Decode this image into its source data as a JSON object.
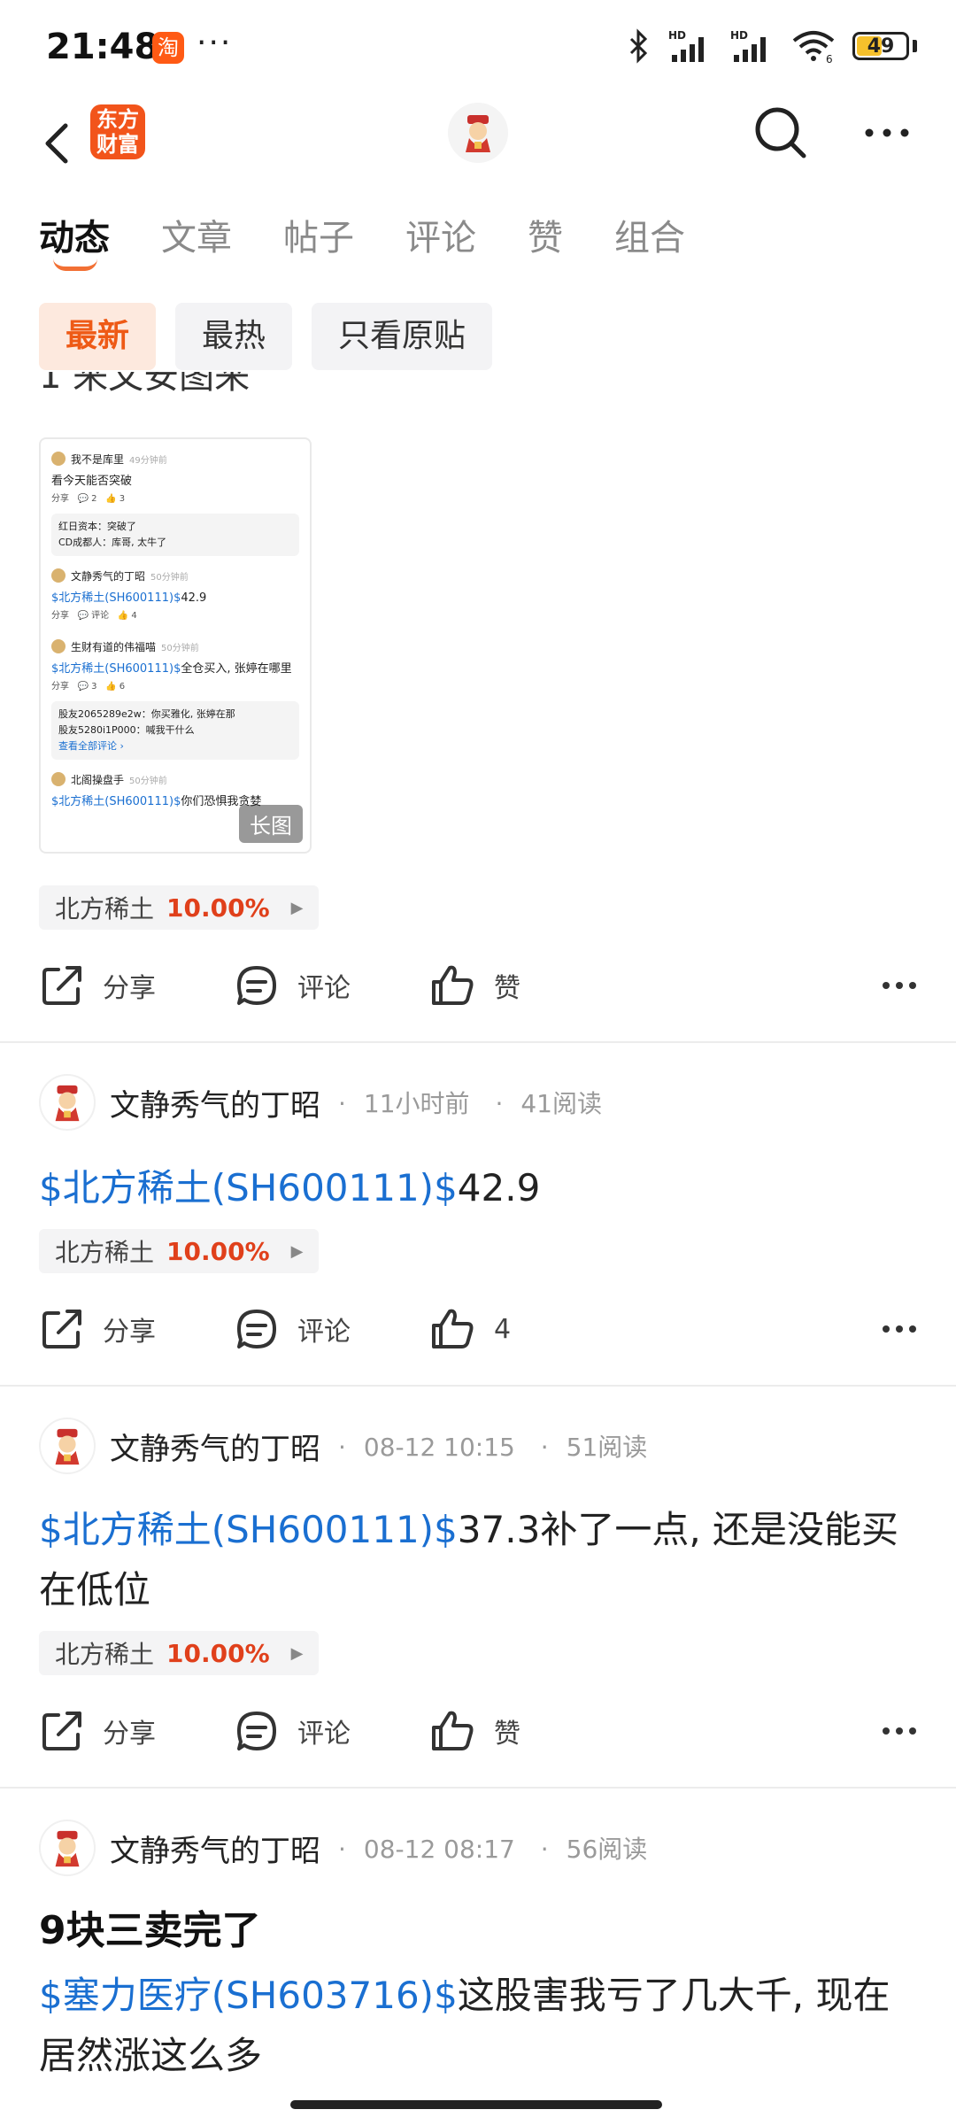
{
  "status": {
    "time": "21:48",
    "taobao_glyph": "淘",
    "more_dots": "···",
    "battery": "49",
    "wifi_badge": "6",
    "hd1": "HD",
    "hd2": "HD"
  },
  "header": {
    "logo_text_line1": "东方",
    "logo_text_line2": "财富"
  },
  "tabs": [
    {
      "label": "动态"
    },
    {
      "label": "文章"
    },
    {
      "label": "帖子"
    },
    {
      "label": "评论"
    },
    {
      "label": "赞"
    },
    {
      "label": "组合"
    }
  ],
  "filters": [
    {
      "label": "最新"
    },
    {
      "label": "最热"
    },
    {
      "label": "只看原贴"
    }
  ],
  "first_post": {
    "clipped_text": "1 来文安图来",
    "thumb_label": "长图",
    "thumb_items": {
      "u1": "我不是库里",
      "u1_time": "49分钟前",
      "t1": "看今天能否突破",
      "a_share": "分享",
      "a1_c": "2",
      "a1_l": "3",
      "c1": "红日资本：突破了",
      "c2": "CD成都人：库哥, 太牛了",
      "u2": "文静秀气的丁昭",
      "u2_time": "50分钟前",
      "t2_link": "$北方稀土(SH600111)$",
      "t2_rest": "42.9",
      "a2_c": "评论",
      "a2_l": "4",
      "u3": "生财有道的伟福喵",
      "u3_time": "50分钟前",
      "t3_link": "$北方稀土(SH600111)$",
      "t3_rest": "全仓买入, 张婷在哪里",
      "a3_c": "3",
      "a3_l": "6",
      "c3": "股友2065289e2w：你买雅化, 张婷在那",
      "c4": "股友5280i1P000：喊我干什么",
      "c5": "查看全部评论 ›",
      "u4": "北阁操盘手",
      "u4_time": "50分钟前",
      "t4_link": "$北方稀土(SH600111)$",
      "t4_rest": "你们恐惧我贪婪"
    },
    "stock_name": "北方稀土",
    "stock_pct": "10.00%",
    "share": "分享",
    "comment": "评论",
    "like": "赞"
  },
  "posts": [
    {
      "author": "文静秀气的丁昭",
      "time": "11小时前",
      "reads": "41阅读",
      "link": "$北方稀土(SH600111)$",
      "text": "42.9",
      "stock_name": "北方稀土",
      "stock_pct": "10.00%",
      "share": "分享",
      "comment": "评论",
      "like": "4"
    },
    {
      "author": "文静秀气的丁昭",
      "time": "08-12 10:15",
      "reads": "51阅读",
      "link": "$北方稀土(SH600111)$",
      "text": "37.3补了一点, 还是没能买在低位",
      "stock_name": "北方稀土",
      "stock_pct": "10.00%",
      "share": "分享",
      "comment": "评论",
      "like": "赞"
    },
    {
      "author": "文静秀气的丁昭",
      "time": "08-12 08:17",
      "reads": "56阅读",
      "title": "9块三卖完了",
      "link": "$塞力医疗(SH603716)$",
      "text": "这股害我亏了几大千, 现在居然涨这么多"
    }
  ],
  "colors": {
    "accent": "#ee5a16",
    "link": "#1a6fd1",
    "up": "#e0401b"
  }
}
